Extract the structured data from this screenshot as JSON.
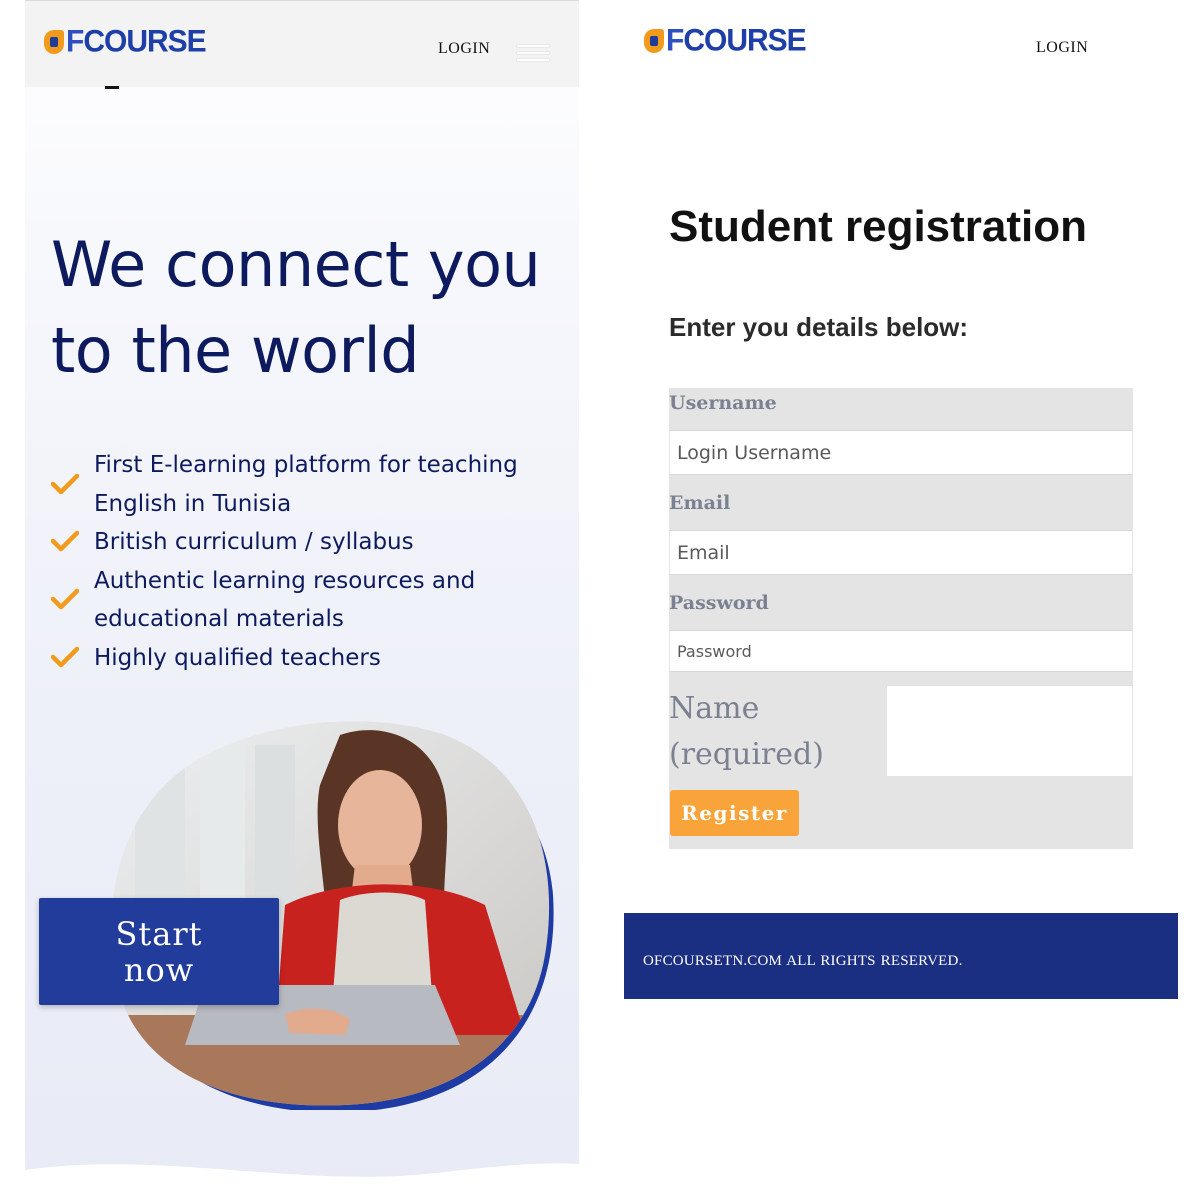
{
  "left_screen": {
    "header": {
      "logo_text": "OFCOURSE",
      "logo_o": "O",
      "logo_f": "F",
      "logo_rest": "COURSE",
      "login_label": "LOGIN",
      "menu_icon": "hamburger-menu-icon"
    },
    "hero": {
      "title_line1": "We connect you",
      "title_line2": "to the world",
      "features": [
        "First E-learning platform for teaching English in Tunisia",
        "British curriculum / syllabus",
        "Authentic learning resources and educational materials",
        "Highly qualified teachers"
      ],
      "start_button_line1": "Start",
      "start_button_line2": "now"
    }
  },
  "right_screen": {
    "header": {
      "logo_text": "OFCOURSE",
      "login_label": "LOGIN"
    },
    "title": "Student registration",
    "subtitle": "Enter you details below:",
    "form": {
      "username_label": "Username",
      "username_placeholder": "Login Username",
      "email_label": "Email",
      "email_placeholder": "Email",
      "password_label": "Password",
      "password_placeholder": "Password",
      "name_label_line1": "Name",
      "name_label_line2": "(required)",
      "register_label": "Register"
    },
    "footer_text": "OFCOURSETN.COM  ALL RIGHTS RESERVED."
  },
  "colors": {
    "brand_blue": "#1f3fa8",
    "brand_orange": "#f29a1c",
    "heading_navy": "#0e1a5e",
    "button_blue": "#223c9c",
    "register_orange": "#f9a43a",
    "footer_blue": "#1a2f82"
  }
}
